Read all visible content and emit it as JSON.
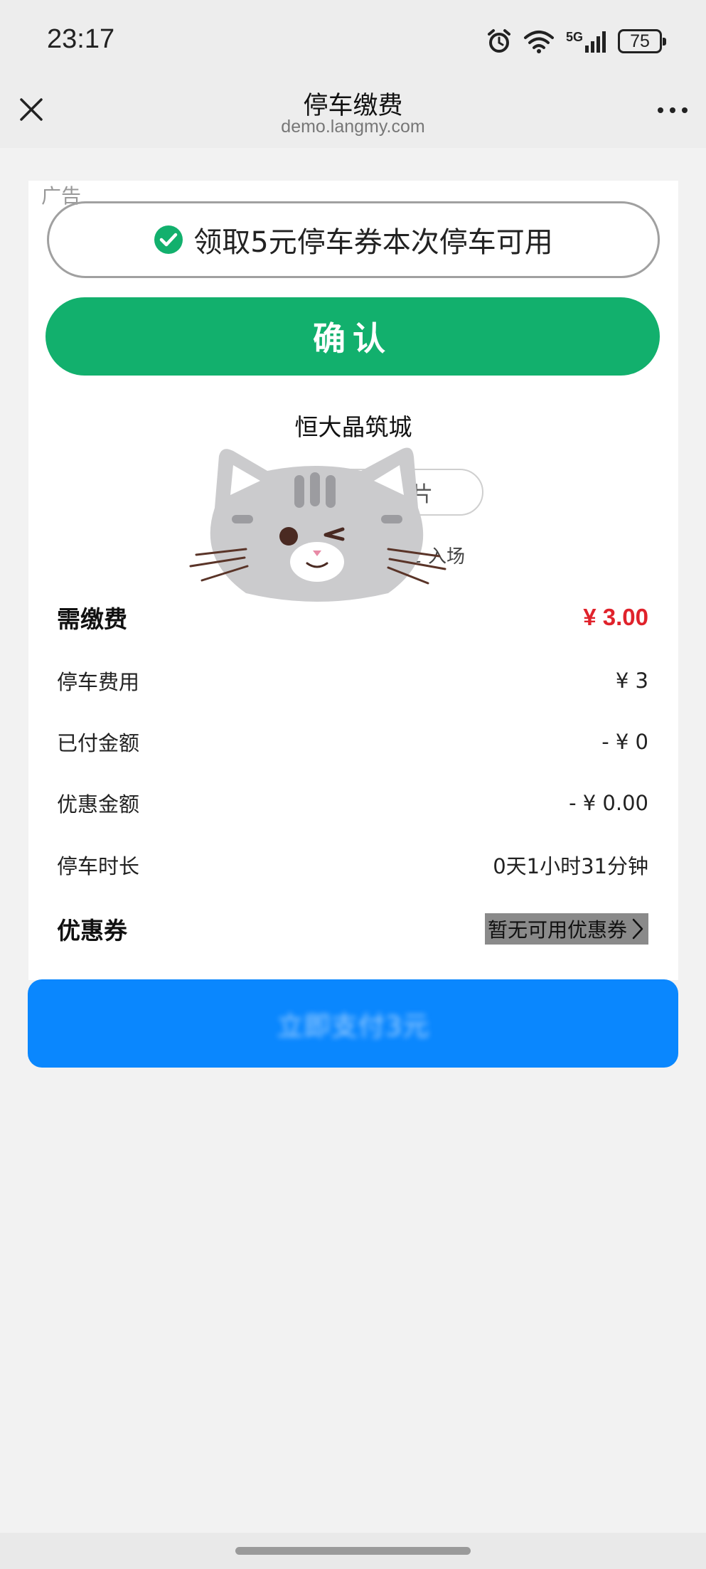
{
  "status_bar": {
    "time": "23:17",
    "network": "5G",
    "battery": "75"
  },
  "titlebar": {
    "title": "停车缴费",
    "subtitle": "demo.langmy.com"
  },
  "ad": {
    "label": "广告",
    "coupon_text": "领取5元停车券本次停车可用",
    "confirm_label": "确认"
  },
  "parking": {
    "lot_name": "恒大晶筑城",
    "view_photo_label": "看图片",
    "entry_text": "2 入场"
  },
  "fees": {
    "due_label": "需缴费",
    "due_value": "¥ 3.00",
    "parking_fee_label": "停车费用",
    "parking_fee_value": "¥ 3",
    "paid_label": "已付金额",
    "paid_value": "- ¥ 0",
    "discount_label": "优惠金额",
    "discount_value": "- ¥ 0.00",
    "duration_label": "停车时长",
    "duration_value": "0天1小时31分钟",
    "coupon_label": "优惠券",
    "coupon_value": "暂无可用优惠券"
  },
  "pay_button": {
    "label": "立即支付3元"
  },
  "colors": {
    "accent_green": "#12b06d",
    "pay_blue": "#0a87fe",
    "due_red": "#e0222b"
  }
}
